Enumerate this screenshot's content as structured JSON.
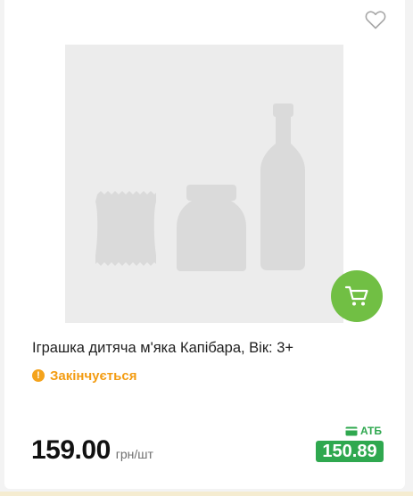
{
  "product": {
    "title": "Іграшка дитяча м'яка Капібара, Вік: 3+",
    "status": "Закінчується",
    "price": "159.00",
    "unit": "грн/шт",
    "loyalty_label": "АТБ",
    "loyalty_price": "150.89"
  },
  "icons": {
    "favorite": "heart-outline-icon",
    "cart": "cart-icon",
    "status": "exclamation-circle-icon",
    "loyalty": "wallet-icon",
    "placeholder": "product-placeholder-icon"
  },
  "colors": {
    "accent_green": "#71bf44",
    "loyalty_green": "#2fa84f",
    "warning_orange": "#f39c12",
    "placeholder_bg": "#ececec",
    "placeholder_shape": "#dadada"
  }
}
